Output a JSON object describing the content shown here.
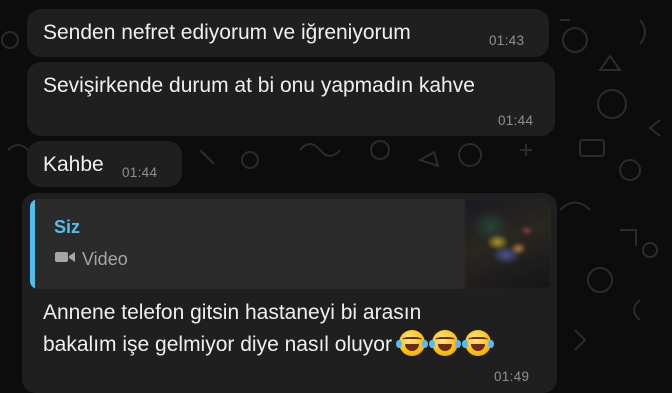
{
  "chat": {
    "messages": [
      {
        "text": "Senden nefret ediyorum ve iğreniyorum",
        "time": "01:43"
      },
      {
        "text": "Sevişirkende durum at bi onu yapmadın kahve",
        "time": "01:44"
      },
      {
        "text": "Kahbe",
        "time": "01:44"
      }
    ],
    "reply": {
      "quote_author": "Siz",
      "quote_type": "Video",
      "thumbnail_icon": "video-thumbnail",
      "lines": [
        "Annene telefon gitsin hastaneyi bi arasın",
        "bakalım işe gelmiyor diye nasıl oluyor"
      ],
      "emojis": [
        "face-with-tears-of-joy-icon",
        "face-with-tears-of-joy-icon",
        "face-with-tears-of-joy-icon"
      ],
      "time": "01:49"
    }
  },
  "colors": {
    "background": "#0c0c0c",
    "bubble": "#1f1f1f",
    "quote_background": "#2b2b2b",
    "quote_accent": "#53bdeb",
    "text": "#efefef",
    "timestamp": "#8f8f8f"
  }
}
